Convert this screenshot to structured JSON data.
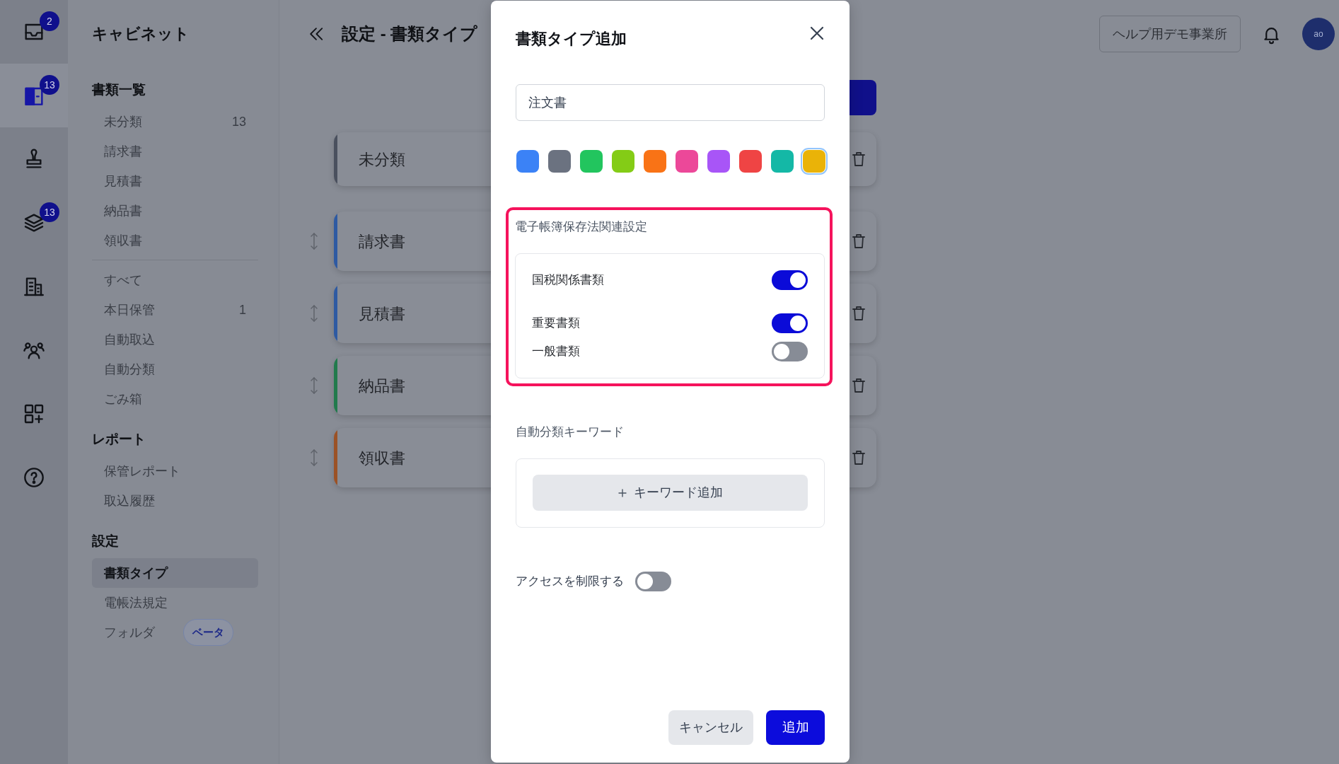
{
  "rail": {
    "items": [
      {
        "badge": "2",
        "selected": false
      },
      {
        "badge": "13",
        "selected": true
      },
      {
        "selected": false
      },
      {
        "badge": "13",
        "selected": false
      },
      {
        "selected": false
      },
      {
        "selected": false
      },
      {
        "selected": false
      },
      {
        "selected": false
      }
    ]
  },
  "sidebar": {
    "title": "キャビネット",
    "sections": [
      {
        "heading": "書類一覧",
        "items": [
          {
            "label": "未分類",
            "count": "13",
            "selected": false
          },
          {
            "label": "請求書",
            "selected": false
          },
          {
            "label": "見積書",
            "selected": false
          },
          {
            "label": "納品書",
            "selected": false
          },
          {
            "label": "領収書",
            "selected": false
          }
        ]
      },
      {
        "divider": true,
        "items": [
          {
            "label": "すべて",
            "selected": false
          },
          {
            "label": "本日保管",
            "count": "1",
            "selected": false
          },
          {
            "label": "自動取込",
            "selected": false
          },
          {
            "label": "自動分類",
            "selected": false
          },
          {
            "label": "ごみ箱",
            "selected": false
          }
        ]
      },
      {
        "heading": "レポート",
        "items": [
          {
            "label": "保管レポート",
            "selected": false
          },
          {
            "label": "取込履歴",
            "selected": false
          }
        ]
      },
      {
        "heading": "設定",
        "items": [
          {
            "label": "書類タイプ",
            "selected": true
          },
          {
            "label": "電帳法規定",
            "selected": false
          },
          {
            "label": "フォルダ",
            "badge": "ベータ",
            "selected": false
          }
        ]
      }
    ]
  },
  "header": {
    "title": "設定 - 書類タイプ",
    "business": "ヘルプ用デモ事業所",
    "avatar": "ao"
  },
  "document_types": [
    {
      "label": "未分類",
      "color": "#4a505e",
      "draggable": false
    },
    {
      "label": "請求書",
      "color": "#2e5aa2",
      "draggable": true
    },
    {
      "label": "見積書",
      "color": "#2e5aa2",
      "draggable": true
    },
    {
      "label": "納品書",
      "color": "#217a4c",
      "draggable": true
    },
    {
      "label": "領収書",
      "color": "#9b5226",
      "draggable": true
    }
  ],
  "dialog": {
    "title": "書類タイプ追加",
    "name_field": {
      "value": "注文書"
    },
    "colors": [
      {
        "color": "#3b82f6",
        "selected": false
      },
      {
        "color": "#6b7280",
        "selected": false
      },
      {
        "color": "#22c55e",
        "selected": false
      },
      {
        "color": "#84cc16",
        "selected": false
      },
      {
        "color": "#f97316",
        "selected": false
      },
      {
        "color": "#ec4899",
        "selected": false
      },
      {
        "color": "#a855f7",
        "selected": false
      },
      {
        "color": "#ef4444",
        "selected": false
      },
      {
        "color": "#14b8a6",
        "selected": false
      },
      {
        "color": "#eab308",
        "selected": true
      }
    ],
    "ebook_settings": {
      "label": "電子帳簿保存法関連設定",
      "highlighted": true,
      "toggles": [
        {
          "label": "国税関係書類",
          "on": true
        },
        {
          "label": "重要書類",
          "on": true
        },
        {
          "label": "一般書類",
          "on": false
        }
      ]
    },
    "keywords": {
      "label": "自動分類キーワード",
      "add_button": "キーワード追加"
    },
    "restrict_access": {
      "label": "アクセスを制限する",
      "on": false
    },
    "buttons": [
      {
        "label": "キャンセル",
        "kind": "secondary"
      },
      {
        "label": "追加",
        "kind": "primary"
      }
    ]
  }
}
